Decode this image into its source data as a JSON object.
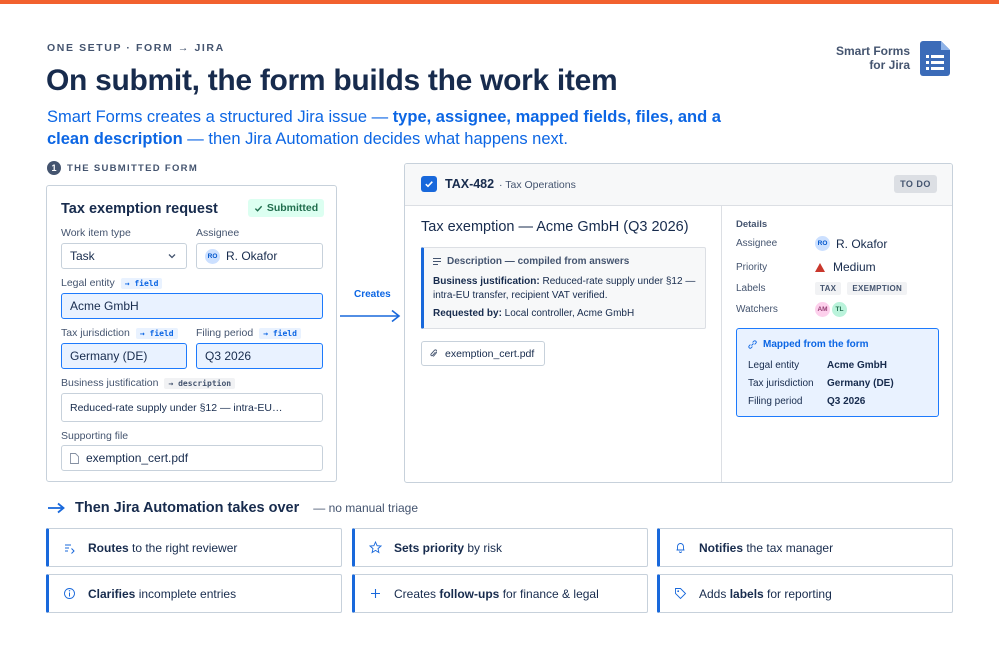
{
  "eyebrow": "ONE SETUP · FORM → JIRA",
  "headline": "On submit, the form builds the work item",
  "subline": {
    "t1": "Smart Forms creates a structured Jira issue — ",
    "b1": "type, assignee, mapped fields, files, and a clean description",
    "t2": " — then Jira Automation decides what happens next."
  },
  "brand": {
    "line1": "Smart Forms",
    "line2": "for Jira",
    "icon": "form-document-icon"
  },
  "step": {
    "number": "1",
    "label": "THE SUBMITTED FORM"
  },
  "form": {
    "title": "Tax exemption request",
    "status": "Submitted",
    "work_item_type": {
      "label": "Work item type",
      "value": "Task"
    },
    "assignee": {
      "label": "Assignee",
      "initials": "RO",
      "value": "R. Okafor"
    },
    "legal_entity": {
      "label": "Legal entity",
      "tag": "→ field",
      "value": "Acme GmbH"
    },
    "tax_jurisdiction": {
      "label": "Tax jurisdiction",
      "tag": "→ field",
      "value": "Germany (DE)"
    },
    "filing_period": {
      "label": "Filing period",
      "tag": "→ field",
      "value": "Q3 2026"
    },
    "business_justification": {
      "label": "Business justification",
      "tag": "→ description",
      "value": "Reduced-rate supply under §12 — intra-EU…"
    },
    "supporting_file": {
      "label": "Supporting file",
      "value": "exemption_cert.pdf"
    }
  },
  "arrow_label": "Creates",
  "issue": {
    "key": "TAX-482",
    "project": "· Tax Operations",
    "status": "TO DO",
    "title": "Tax exemption — Acme GmbH (Q3 2026)",
    "description": {
      "heading": "Description — compiled from answers",
      "justification_label": "Business justification:",
      "justification_text": " Reduced-rate supply under §12 — intra-EU transfer, recipient VAT verified.",
      "requested_label": "Requested by:",
      "requested_text": " Local controller, Acme GmbH"
    },
    "attachment": "exemption_cert.pdf",
    "details": {
      "heading": "Details",
      "assignee_label": "Assignee",
      "assignee_initials": "RO",
      "assignee_value": "R. Okafor",
      "priority_label": "Priority",
      "priority_value": "Medium",
      "priority_color": "#C9372C",
      "labels_label": "Labels",
      "labels": [
        "TAX",
        "EXEMPTION"
      ],
      "watchers_label": "Watchers",
      "watchers": [
        "AM",
        "TL"
      ]
    },
    "mapped": {
      "heading": "Mapped from the form",
      "rows": [
        {
          "label": "Legal entity",
          "value": "Acme GmbH"
        },
        {
          "label": "Tax jurisdiction",
          "value": "Germany (DE)"
        },
        {
          "label": "Filing period",
          "value": "Q3 2026"
        }
      ]
    }
  },
  "automation": {
    "title": "Then Jira Automation takes over",
    "subtitle": "— no manual triage",
    "tiles": [
      {
        "bold": "Routes",
        "text": " to the right reviewer",
        "icon": "route-icon"
      },
      {
        "bold": "Sets priority",
        "text": " by risk",
        "icon": "star-icon"
      },
      {
        "pre": "",
        "bold": "Notifies",
        "text": " the tax manager",
        "icon": "bell-icon"
      },
      {
        "bold": "Clarifies",
        "text": " incomplete entries",
        "icon": "info-icon"
      },
      {
        "pre": "Creates ",
        "bold": "follow-ups",
        "text": " for finance & legal",
        "icon": "plus-icon"
      },
      {
        "pre": "Adds ",
        "bold": "labels",
        "text": " for reporting",
        "icon": "tag-icon"
      }
    ]
  },
  "colors": {
    "accent": "#0C66E4",
    "top_bar": "#F2612E",
    "success": "#216E4E"
  }
}
